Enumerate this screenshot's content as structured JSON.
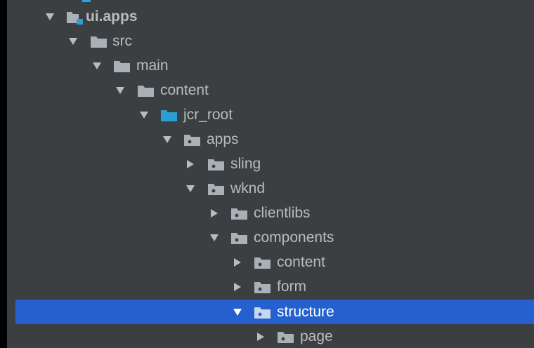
{
  "tree": {
    "rows": [
      {
        "label": "ui.apps",
        "state": "expanded",
        "folder_type": "module"
      },
      {
        "label": "src",
        "state": "expanded",
        "folder_type": "plain"
      },
      {
        "label": "main",
        "state": "expanded",
        "folder_type": "plain"
      },
      {
        "label": "content",
        "state": "expanded",
        "folder_type": "plain"
      },
      {
        "label": "jcr_root",
        "state": "expanded",
        "folder_type": "source"
      },
      {
        "label": "apps",
        "state": "expanded",
        "folder_type": "package"
      },
      {
        "label": "sling",
        "state": "collapsed",
        "folder_type": "package"
      },
      {
        "label": "wknd",
        "state": "expanded",
        "folder_type": "package"
      },
      {
        "label": "clientlibs",
        "state": "collapsed",
        "folder_type": "package"
      },
      {
        "label": "components",
        "state": "expanded",
        "folder_type": "package"
      },
      {
        "label": "content",
        "state": "collapsed",
        "folder_type": "package"
      },
      {
        "label": "form",
        "state": "collapsed",
        "folder_type": "package"
      },
      {
        "label": "structure",
        "state": "expanded",
        "folder_type": "package",
        "selected": true
      },
      {
        "label": "page",
        "state": "collapsed",
        "folder_type": "package"
      }
    ]
  },
  "colors": {
    "panel_bg": "#3c3f41",
    "text": "#bbbbbb",
    "selected_bg": "#2461ce",
    "selected_text": "#ffffff",
    "folder_gray": "#a9b0b6",
    "folder_source": "#2a9fd6"
  },
  "icons": {
    "expanded": "triangle-down-icon",
    "collapsed": "triangle-right-icon",
    "module": "module-folder-icon",
    "plain": "folder-icon",
    "source": "source-root-folder-icon",
    "package": "package-folder-icon"
  }
}
